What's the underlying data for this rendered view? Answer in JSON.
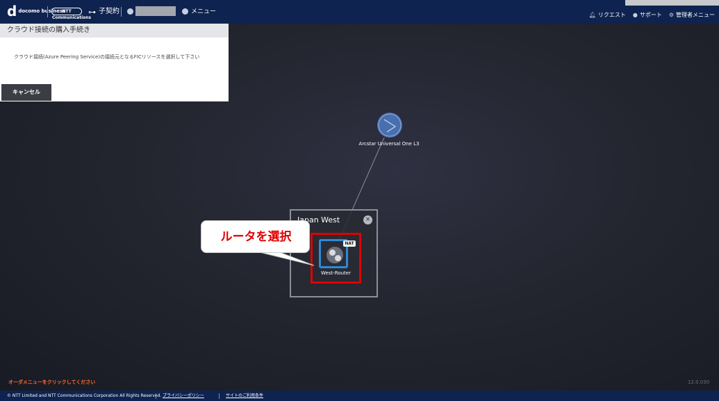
{
  "header": {
    "logo_docomo_mark": "d",
    "logo_docomo_text": "docomo business",
    "logo_ntt_text": "NTT Communications",
    "contract_label": "子契約",
    "menu_label": "メニュー",
    "nav_right": [
      {
        "icon": "bell-icon",
        "label": "リクエスト"
      },
      {
        "icon": "question-icon",
        "label": "サポート"
      },
      {
        "icon": "gear-icon",
        "label": "管理者メニュー"
      }
    ]
  },
  "panel": {
    "title": "クラウド接続の購入手続き",
    "description": "クラウド接続(Azure Peering Service)の接続元となるFICリソースを選択して下さい",
    "cancel_label": "キャンセル"
  },
  "nodes": {
    "cloud_label": "Arcstar Universal One L3",
    "region_title": "Japan West",
    "region_close": "×",
    "router_label": "West-Router",
    "router_badge": "NAT"
  },
  "callout": {
    "text": "ルータを選択"
  },
  "status": {
    "order_hint": "オーダメニューをクリックしてください",
    "version": "12.0.030"
  },
  "footer": {
    "copyright": "© NTT Limited and NTT Communications Corporation All Rights Reserved.",
    "privacy_label": "プライバシーポリシー",
    "terms_label": "サイトのご利用条件"
  },
  "colors": {
    "header_bg": "#0f2350",
    "accent_blue": "#2f8ad6",
    "highlight_red": "#e00000",
    "hint_orange": "#ff6a2a"
  }
}
